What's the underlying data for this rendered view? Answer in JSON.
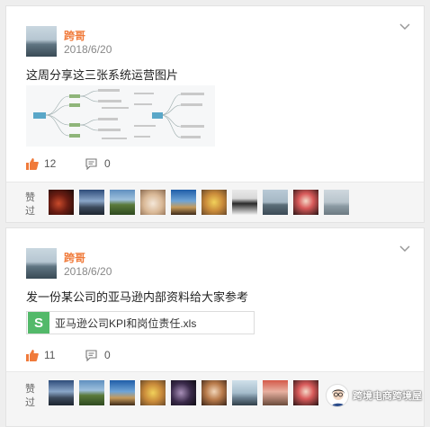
{
  "posts": [
    {
      "author": "跨哥",
      "date": "2018/6/20",
      "text": "这周分享这三张系统运营图片",
      "likes": "12",
      "comments": "0",
      "liked_label": "赞过"
    },
    {
      "author": "跨哥",
      "date": "2018/6/20",
      "text": "发一份某公司的亚马逊内部资料给大家参考",
      "file": {
        "icon": "S",
        "name": "亚马逊公司KPI和岗位责任.xls"
      },
      "likes": "11",
      "comments": "0",
      "liked_label": "赞过"
    }
  ],
  "watermark": "跨境电商跨境屋",
  "colors": {
    "accent": "#f07a3a",
    "file_icon": "#53b96a"
  },
  "icons": [
    "chevron-down-icon",
    "thumbs-up-icon",
    "comment-icon",
    "excel-file-icon"
  ]
}
